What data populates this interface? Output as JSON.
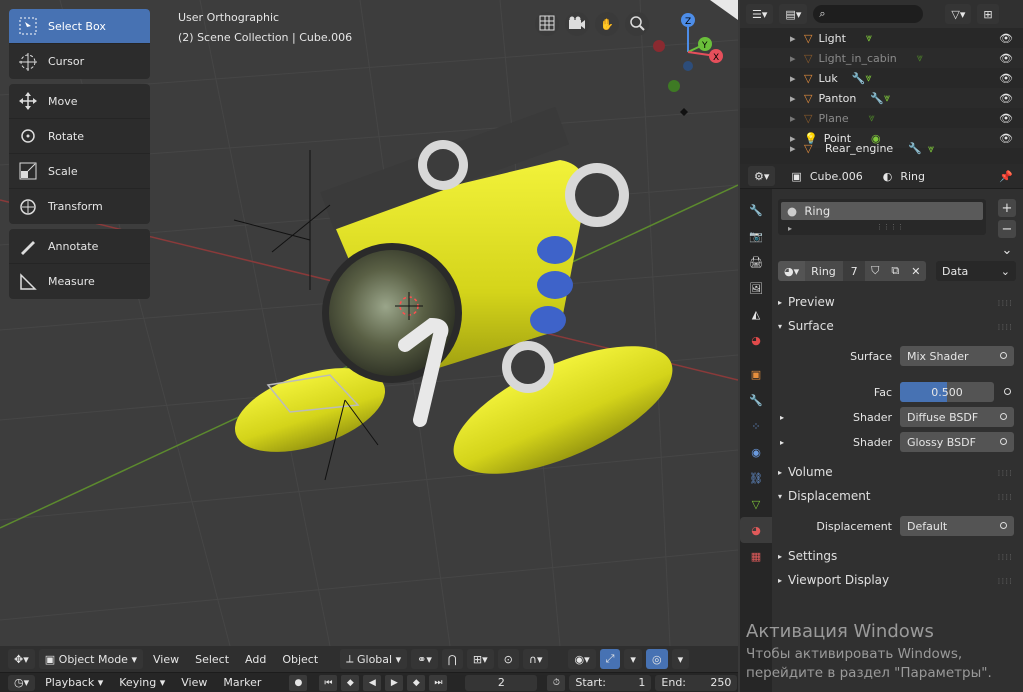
{
  "viewport": {
    "title_line1": "User Orthographic",
    "title_line2": "(2) Scene Collection | Cube.006",
    "tools": [
      {
        "label": "Select Box",
        "icon": "select-box-icon",
        "active": true
      },
      {
        "label": "Cursor",
        "icon": "cursor-icon"
      },
      {
        "label": "Move",
        "icon": "move-icon"
      },
      {
        "label": "Rotate",
        "icon": "rotate-icon"
      },
      {
        "label": "Scale",
        "icon": "scale-icon"
      },
      {
        "label": "Transform",
        "icon": "transform-icon"
      },
      {
        "label": "Annotate",
        "icon": "annotate-icon"
      },
      {
        "label": "Measure",
        "icon": "measure-icon"
      }
    ],
    "gizmo": {
      "x": "X",
      "y": "Y",
      "z": "Z"
    }
  },
  "header": {
    "mode": "Object Mode",
    "menu": [
      "View",
      "Select",
      "Add",
      "Object"
    ],
    "orientation": "Global"
  },
  "timeline": {
    "menu": [
      "Playback",
      "Keying",
      "View",
      "Marker"
    ],
    "current_frame": "2",
    "start_label": "Start:",
    "start": "1",
    "end_label": "End:",
    "end": "250"
  },
  "outliner": {
    "items": [
      {
        "name": "Light",
        "dim": false
      },
      {
        "name": "Light_in_cabin",
        "dim": true
      },
      {
        "name": "Luk",
        "dim": false
      },
      {
        "name": "Panton",
        "dim": false
      },
      {
        "name": "Plane",
        "dim": true
      },
      {
        "name": "Point",
        "dim": false
      },
      {
        "name": "Rear_engine",
        "dim": false
      }
    ]
  },
  "properties": {
    "object": "Cube.006",
    "material": "Ring",
    "slot_name": "Ring",
    "mat_name": "Ring",
    "users": "7",
    "link": "Data",
    "panels": {
      "preview": "Preview",
      "surface": "Surface",
      "volume": "Volume",
      "displacement": "Displacement",
      "settings": "Settings",
      "viewport_display": "Viewport Display"
    },
    "surface_label": "Surface",
    "surface_value": "Mix Shader",
    "fac_label": "Fac",
    "fac_value": "0.500",
    "fac_fraction": 0.5,
    "shader1_label": "Shader",
    "shader1_value": "Diffuse BSDF",
    "shader2_label": "Shader",
    "shader2_value": "Glossy BSDF",
    "displacement_label": "Displacement",
    "displacement_value": "Default"
  },
  "windows_activation": {
    "line1": "Активация Windows",
    "line2": "Чтобы активировать Windows,",
    "line3": "перейдите в раздел \"Параметры\"."
  },
  "colors": {
    "accent": "#4772b3",
    "yellow": "#e1e11e",
    "outliner_green": "#7ec73a",
    "object_orange": "#e78f3d"
  }
}
